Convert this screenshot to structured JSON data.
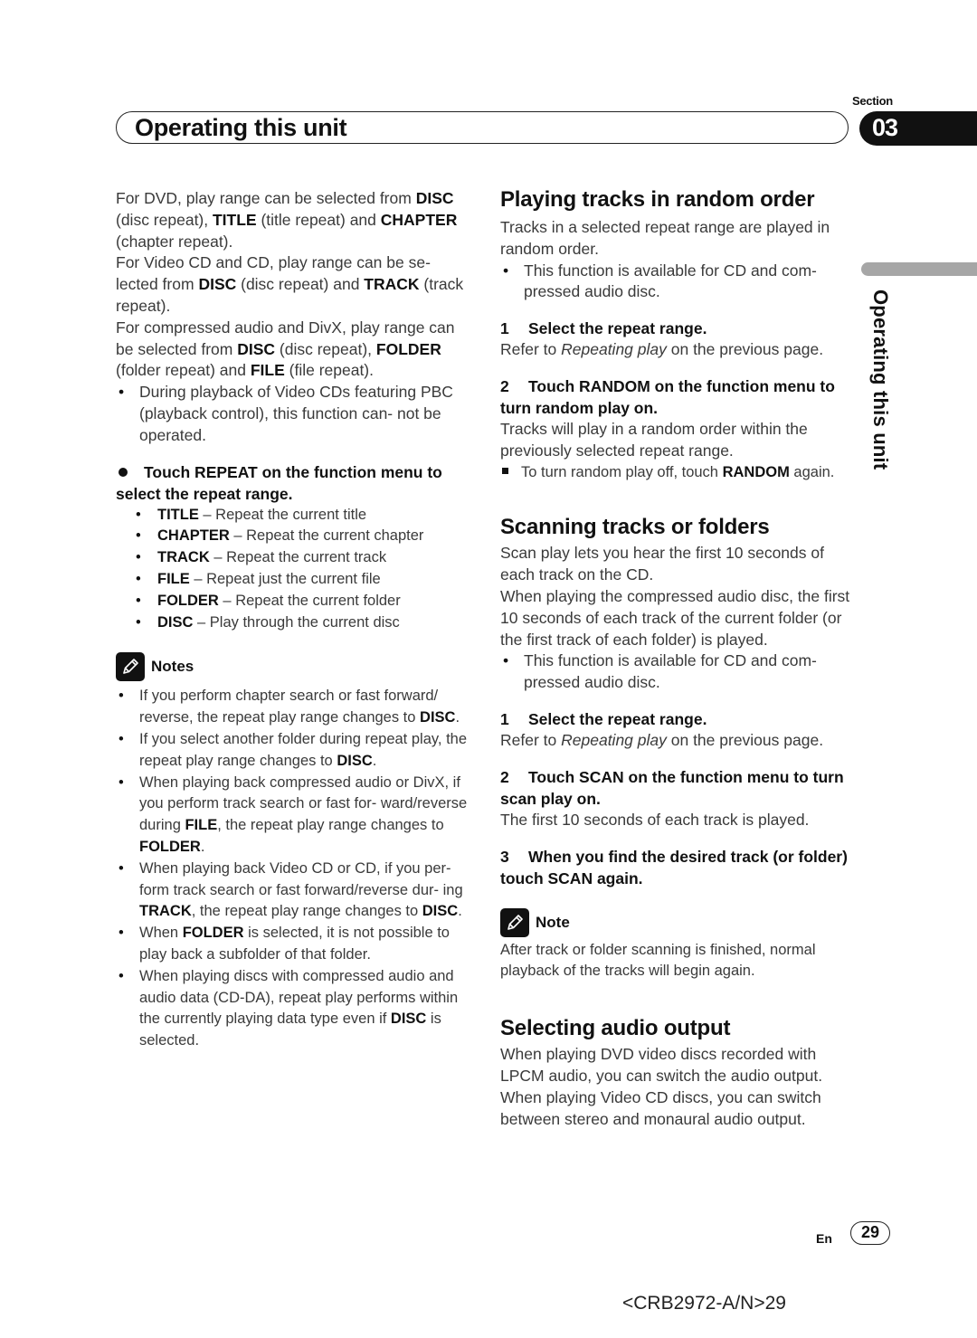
{
  "header": {
    "section_label": "Section",
    "title": "Operating this unit",
    "section_number": "03"
  },
  "side_tab": {
    "label": "Operating this unit"
  },
  "left_column": {
    "intro": [
      [
        {
          "t": "For DVD, play range can be selected from "
        },
        {
          "b": "DISC"
        },
        {
          "t": " (disc repeat), "
        },
        {
          "b": "TITLE"
        },
        {
          "t": " (title repeat) and "
        },
        {
          "b": "CHAPTER"
        },
        {
          "t": " (chapter repeat)."
        }
      ],
      [
        {
          "t": "For Video CD and CD, play range can be se- lected from "
        },
        {
          "b": "DISC"
        },
        {
          "t": " (disc repeat) and "
        },
        {
          "b": "TRACK"
        },
        {
          "t": " (track repeat)."
        }
      ],
      [
        {
          "t": "For compressed audio and DivX, play range can be selected from "
        },
        {
          "b": "DISC"
        },
        {
          "t": " (disc repeat), "
        },
        {
          "b": "FOLDER"
        },
        {
          "t": " (folder repeat) and "
        },
        {
          "b": "FILE"
        },
        {
          "t": " (file repeat)."
        }
      ]
    ],
    "intro_bullet": "During playback of Video CDs featuring PBC (playback control), this function can- not be operated.",
    "step_heading": "Touch REPEAT on the function menu to select the repeat range.",
    "repeat_options": [
      {
        "key": "TITLE",
        "desc": " – Repeat the current title"
      },
      {
        "key": "CHAPTER",
        "desc": " – Repeat the current chapter"
      },
      {
        "key": "TRACK",
        "desc": " – Repeat the current track"
      },
      {
        "key": "FILE",
        "desc": " – Repeat just the current file"
      },
      {
        "key": "FOLDER",
        "desc": " – Repeat the current folder"
      },
      {
        "key": "DISC",
        "desc": " – Play through the current disc"
      }
    ],
    "notes_label": "Notes",
    "notes": [
      [
        {
          "t": "If you perform chapter search or fast forward/ reverse, the repeat play range changes to "
        },
        {
          "b": "DISC"
        },
        {
          "t": "."
        }
      ],
      [
        {
          "t": "If you select another folder during repeat play, the repeat play range changes to "
        },
        {
          "b": "DISC"
        },
        {
          "t": "."
        }
      ],
      [
        {
          "t": "When playing back compressed audio or DivX, if you perform track search or fast for- ward/reverse during "
        },
        {
          "b": "FILE"
        },
        {
          "t": ", the repeat play range changes to "
        },
        {
          "b": "FOLDER"
        },
        {
          "t": "."
        }
      ],
      [
        {
          "t": "When playing back Video CD or CD, if you per- form track search or fast forward/reverse dur- ing "
        },
        {
          "b": "TRACK"
        },
        {
          "t": ", the repeat play range changes to "
        },
        {
          "b": "DISC"
        },
        {
          "t": "."
        }
      ],
      [
        {
          "t": "When "
        },
        {
          "b": "FOLDER"
        },
        {
          "t": " is selected, it is not possible to play back a subfolder of that folder."
        }
      ],
      [
        {
          "t": "When playing discs with compressed audio and audio data (CD-DA), repeat play performs within the currently playing data type even if "
        },
        {
          "b": "DISC"
        },
        {
          "t": " is selected."
        }
      ]
    ]
  },
  "right_column": {
    "random": {
      "heading": "Playing tracks in random order",
      "intro": "Tracks in a selected repeat range are played in random order.",
      "bullet": "This function is available for CD and com- pressed audio disc.",
      "step1_num": "1",
      "step1": "Select the repeat range.",
      "step1_text_pre": "Refer to ",
      "step1_text_italic": "Repeating play",
      "step1_text_post": " on the previous page.",
      "step2_num": "2",
      "step2": "Touch RANDOM on the function menu to turn random play on.",
      "step2_text": "Tracks will play in a random order within the previously selected repeat range.",
      "off_note_pre": "To turn random play off, touch ",
      "off_note_bold": "RANDOM",
      "off_note_post": " again."
    },
    "scan": {
      "heading": "Scanning tracks or folders",
      "intro1": "Scan play lets you hear the first 10 seconds of each track on the CD.",
      "intro2": "When playing the compressed audio disc, the first 10 seconds of each track of the current folder (or the first track of each folder) is played.",
      "bullet": "This function is available for CD and com- pressed audio disc.",
      "step1_num": "1",
      "step1": "Select the repeat range.",
      "step1_text_pre": "Refer to ",
      "step1_text_italic": "Repeating play",
      "step1_text_post": " on the previous page.",
      "step2_num": "2",
      "step2": "Touch SCAN on the function menu to turn scan play on.",
      "step2_text": "The first 10 seconds of each track is played.",
      "step3_num": "3",
      "step3": "When you find the desired track (or folder) touch SCAN again.",
      "note_label": "Note",
      "note_text": "After track or folder scanning is finished, normal playback of the tracks will begin again."
    },
    "audio_output": {
      "heading": "Selecting audio output",
      "text": "When playing DVD video discs recorded with LPCM audio, you can switch the audio output. When playing Video CD discs, you can switch between stereo and monaural audio output."
    }
  },
  "footer": {
    "language": "En",
    "page_number": "29",
    "doc_code": "<CRB2972-A/N>29"
  }
}
